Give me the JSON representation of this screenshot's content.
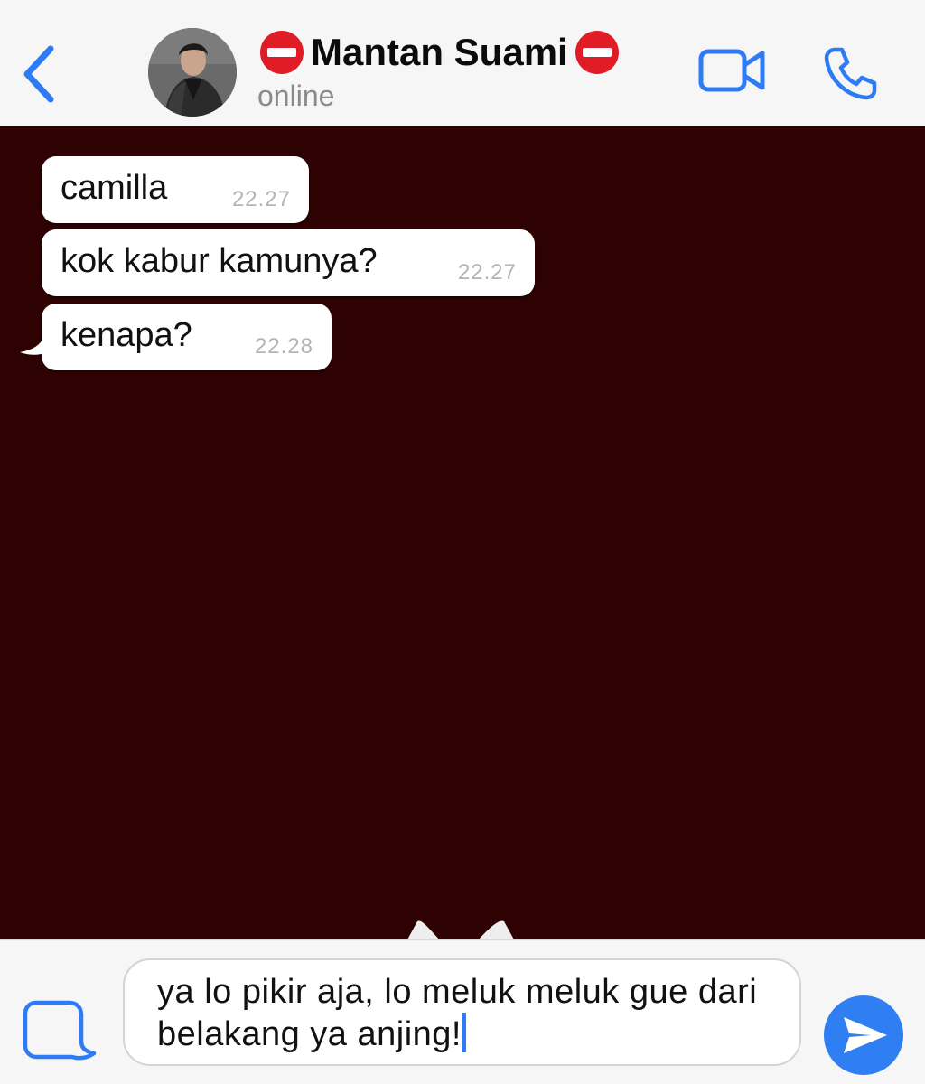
{
  "header": {
    "contact_name": "Mantan Suami",
    "status": "online",
    "back_icon": "chevron-left-icon",
    "video_icon": "video-camera-icon",
    "call_icon": "phone-icon",
    "title_emoji": "no-entry-icon",
    "accent_color": "#2e7bf6"
  },
  "chat": {
    "background_color": "#2e0202",
    "messages": [
      {
        "text": "camilla",
        "time": "22.27"
      },
      {
        "text": "kok kabur kamunya?",
        "time": "22.27"
      },
      {
        "text": "kenapa?",
        "time": "22.28"
      }
    ]
  },
  "composer": {
    "value": "ya lo pikir aja, lo meluk meluk gue dari belakang ya anjing!",
    "attach_icon": "sticker-icon",
    "send_icon": "send-icon"
  }
}
